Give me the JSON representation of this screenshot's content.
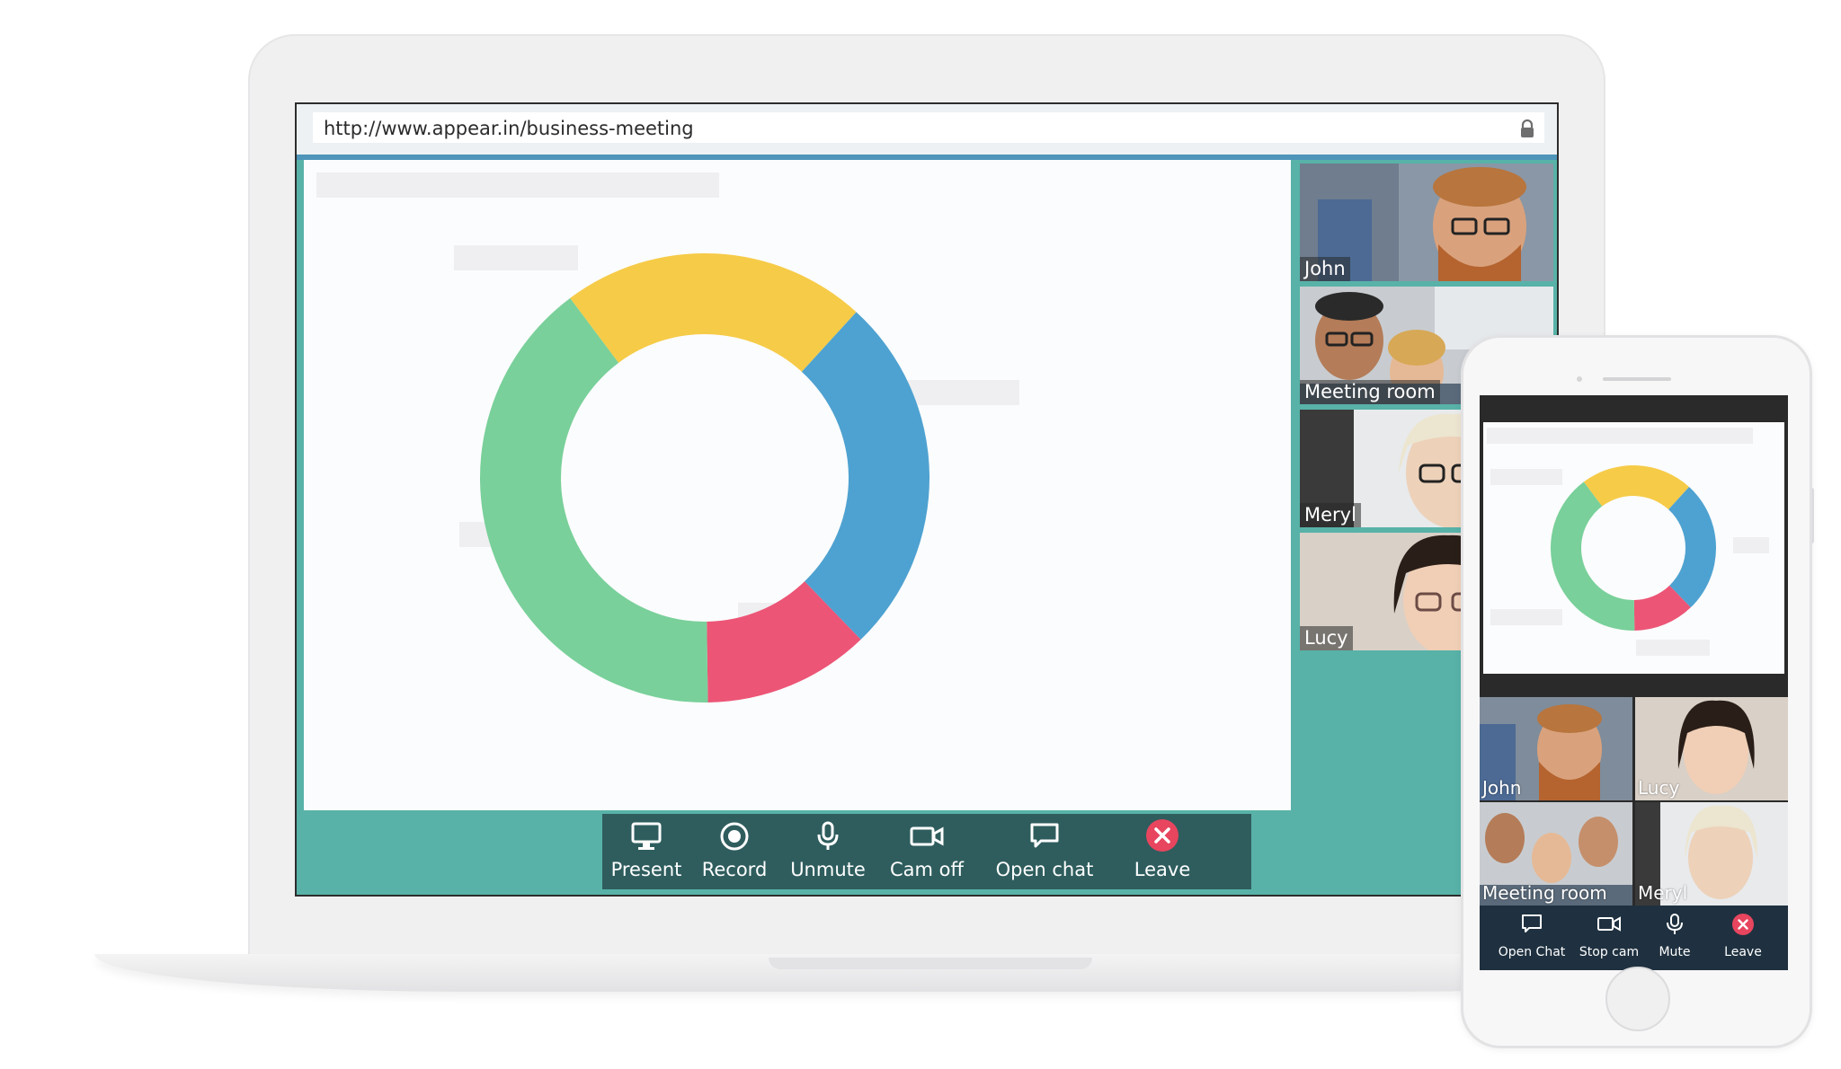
{
  "browser": {
    "url": "http://www.appear.in/business-meeting",
    "lock_icon": "lock-icon"
  },
  "slide": {
    "chart_data": {
      "type": "pie",
      "variant": "donut",
      "values": [
        12,
        40,
        22,
        26
      ],
      "colors": [
        "#ec5576",
        "#79d09a",
        "#f6cb48",
        "#4ea2d1"
      ],
      "unit": "percent (estimated)"
    }
  },
  "participants": [
    {
      "name": "John",
      "icon": "person-icon"
    },
    {
      "name": "Meeting room",
      "icon": "group-icon"
    },
    {
      "name": "Meryl",
      "icon": "person-icon"
    },
    {
      "name": "Lucy",
      "icon": "person-icon"
    }
  ],
  "toolbar": {
    "present": {
      "label": "Present",
      "icon": "monitor-icon"
    },
    "record": {
      "label": "Record",
      "icon": "record-icon"
    },
    "unmute": {
      "label": "Unmute",
      "icon": "microphone-icon"
    },
    "cam_off": {
      "label": "Cam off",
      "icon": "camera-icon"
    },
    "open_chat": {
      "label": "Open chat",
      "icon": "chat-icon"
    },
    "leave": {
      "label": "Leave",
      "icon": "close-icon",
      "color": "#e8455e"
    }
  },
  "phone": {
    "tiles": [
      "John",
      "Lucy",
      "Meeting room",
      "Meryl"
    ],
    "toolbar": {
      "open_chat": "Open Chat",
      "stop_cam": "Stop cam",
      "mute": "Mute",
      "leave": "Leave"
    }
  },
  "colors": {
    "accent_teal": "#58b2a8",
    "toolbar_dark": "#2f5d5e",
    "url_border_blue": "#4e95b9",
    "phone_toolbar": "#1f3140"
  }
}
